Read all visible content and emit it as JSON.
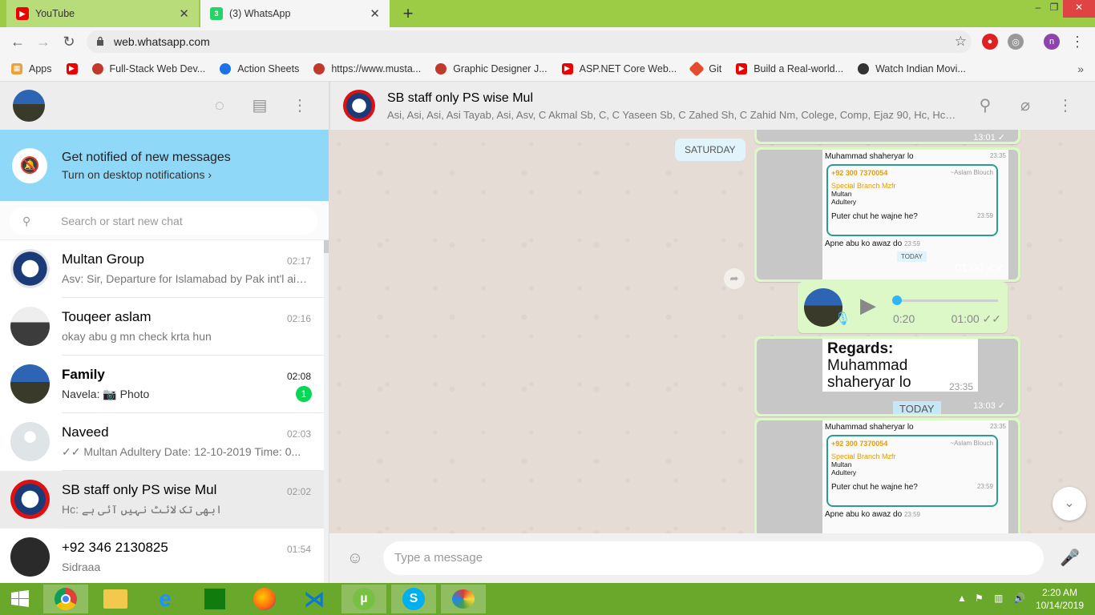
{
  "browser": {
    "tabs": [
      {
        "title": "YouTube",
        "active": false
      },
      {
        "title": "(3) WhatsApp",
        "active": true
      }
    ],
    "url": "web.whatsapp.com",
    "profile_initial": "n",
    "bookmarks": [
      {
        "label": "Apps",
        "icon": "apps-grid-icon"
      },
      {
        "label": "",
        "icon": "youtube-icon"
      },
      {
        "label": "Full-Stack Web Dev...",
        "icon": "bookmark-site-icon"
      },
      {
        "label": "Action Sheets",
        "icon": "bookmark-site-icon"
      },
      {
        "label": "https://www.musta...",
        "icon": "bookmark-site-icon"
      },
      {
        "label": "Graphic Designer J...",
        "icon": "bookmark-site-icon"
      },
      {
        "label": "ASP.NET Core Web...",
        "icon": "youtube-icon"
      },
      {
        "label": "Git",
        "icon": "git-icon"
      },
      {
        "label": "Build a Real-world...",
        "icon": "youtube-icon"
      },
      {
        "label": "Watch Indian Movi...",
        "icon": "bookmark-site-icon"
      }
    ]
  },
  "sidebar": {
    "notification": {
      "title": "Get notified of new messages",
      "subtitle": "Turn on desktop notifications ›"
    },
    "search_placeholder": "Search or start new chat",
    "chats": [
      {
        "name": "Multan Group",
        "time": "02:17",
        "preview": "Asv: Sir, Departure for Islamabad by Pak int'l airl...",
        "unread": "",
        "selected": false
      },
      {
        "name": "Touqeer aslam",
        "time": "02:16",
        "preview": "okay abu g mn check krta hun",
        "unread": "",
        "selected": false
      },
      {
        "name": "Family",
        "time": "02:08",
        "preview": "Navela: 📷 Photo",
        "unread": "1",
        "selected": false
      },
      {
        "name": "Naveed",
        "time": "02:03",
        "preview": "✓✓ Multan Adultery Date: 12-10-2019 Time: 0...",
        "unread": "",
        "selected": false
      },
      {
        "name": "SB staff only PS wise Mul",
        "time": "02:02",
        "preview": "Hc: ابھی تک لائٹ نہیں آئی ہے",
        "unread": "",
        "selected": true
      },
      {
        "name": "+92 346 2130825",
        "time": "01:54",
        "preview": "Sidraaa",
        "unread": "",
        "selected": false
      }
    ]
  },
  "conversation": {
    "group_name": "SB staff only PS wise Mul",
    "members": "Asi, Asi, Asi, Asi Tayab, Asi, Asv, C Akmal Sb, C, C Yaseen Sb, C Zahed Sh, C Zahid Nm, Colege, Comp, Ejaz 90, Hc, Hc Fahe...",
    "date_chip": "SATURDAY",
    "top_stamp": "13:01 ✓",
    "image1": {
      "line1": "Muhammad shaheryar lo",
      "t1": "23:35",
      "phone": "+92 300 7370054",
      "from": "~Aslam Blouch",
      "org": "Special Branch Mzfr",
      "city": "Multan",
      "subject": "Adultery",
      "msg1": "Puter chut he wajne he?",
      "t2": "23:59",
      "msg2": "Apne abu ko awaz do",
      "t3": "23:59",
      "today": "TODAY",
      "stamp": "01:00 ✓✓"
    },
    "audio": {
      "elapsed": "0:20",
      "stamp": "01:00 ✓✓",
      "progress": 0.0
    },
    "image2": {
      "line1": "Regards:",
      "line2": "Muhammad",
      "line3": "shaheryar lo",
      "t1": "23:35",
      "today": "TODAY",
      "stamp": "13:03 ✓"
    },
    "image3": {
      "line1": "Muhammad shaheryar lo",
      "t1": "23:35",
      "phone": "+92 300 7370054",
      "from": "~Aslam Blouch",
      "org": "Special Branch Mzfr",
      "city": "Multan",
      "subject": "Adultery",
      "msg1": "Puter chut he wajne he?",
      "t2": "23:59",
      "msg2": "Apne abu ko awaz do",
      "t3": "23:59"
    },
    "composer_placeholder": "Type a message"
  },
  "taskbar": {
    "time": "2:20 AM",
    "date": "10/14/2019"
  },
  "colors": {
    "accent": "#06d755",
    "header_bg": "#ededed",
    "outgoing_bubble": "#dcf8c6",
    "notification_bg": "#8fd8f8",
    "chrome_frame": "#9ccc45"
  }
}
